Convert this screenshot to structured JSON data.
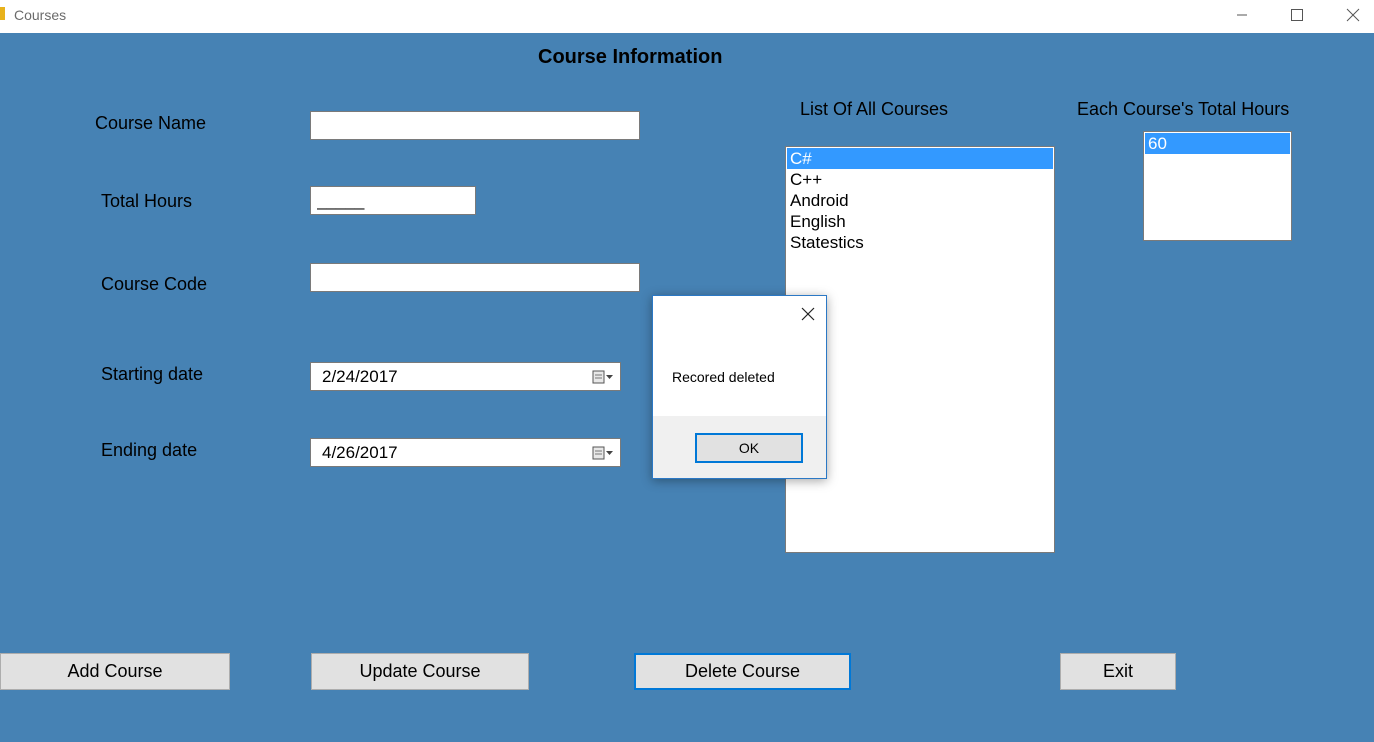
{
  "window": {
    "title": "Courses"
  },
  "form": {
    "heading": "Course Information",
    "course_name_label": "Course Name",
    "course_name_value": "",
    "total_hours_label": "Total Hours",
    "total_hours_value": "_____",
    "course_code_label": "Course Code",
    "course_code_value": "",
    "starting_date_label": "Starting date",
    "starting_date_value": "2/24/2017",
    "ending_date_label": "Ending date",
    "ending_date_value": "4/26/2017"
  },
  "courses_list": {
    "label": "List Of All Courses",
    "items": [
      "C#",
      "C++",
      "Android",
      "English",
      "Statestics"
    ],
    "selected_index": 0
  },
  "hours_list": {
    "label": "Each Course's Total Hours",
    "items": [
      "60"
    ],
    "selected_index": 0
  },
  "buttons": {
    "add": "Add Course",
    "update": "Update Course",
    "delete": "Delete Course",
    "exit": "Exit"
  },
  "dialog": {
    "message": "Recored deleted",
    "ok_label": "OK"
  },
  "colors": {
    "background": "#4682b4",
    "selection": "#3399ff",
    "focus_border": "#0078d7"
  }
}
